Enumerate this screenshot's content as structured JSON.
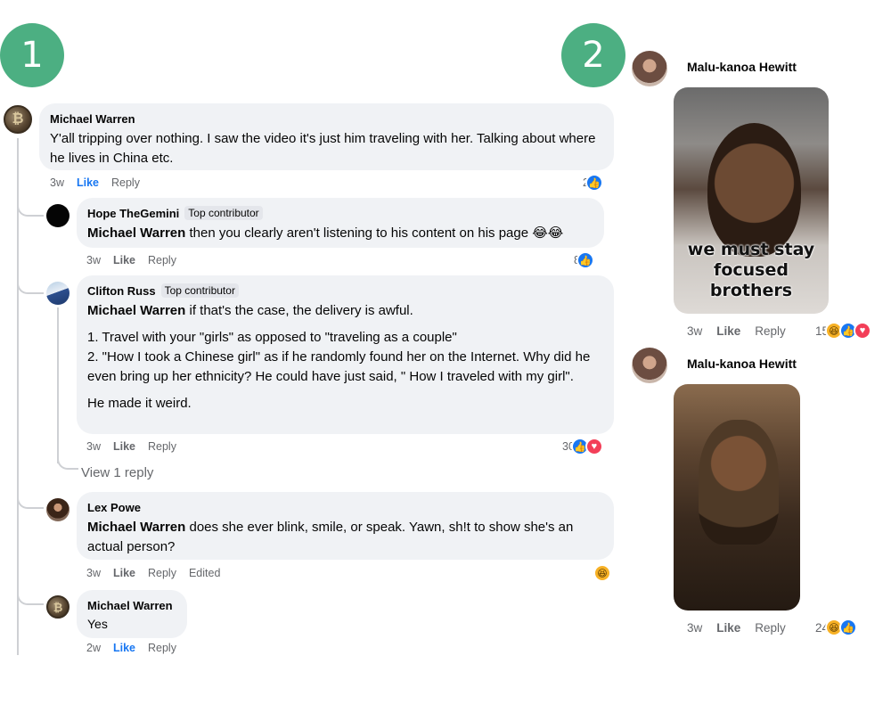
{
  "badges": {
    "left": "1",
    "right": "2"
  },
  "left_thread": {
    "main_comment": {
      "author": "Michael Warren",
      "text": "Y'all tripping over nothing. I saw the video it's just him traveling with her. Talking about where he lives in China etc.",
      "time": "3w",
      "like": "Like",
      "reply": "Reply",
      "reaction_count": "2",
      "reactions": [
        "like-icon"
      ]
    },
    "replies": [
      {
        "author": "Hope TheGemini",
        "tag": "Top contributor",
        "mention": "Michael Warren",
        "text": " then you clearly aren't listening to his content on his page 😂😂",
        "time": "3w",
        "like": "Like",
        "reply": "Reply",
        "reaction_count": "8",
        "reactions": [
          "like-icon"
        ]
      },
      {
        "author": "Clifton Russ",
        "tag": "Top contributor",
        "mention": "Michael Warren",
        "text": " if that's the case, the delivery is awful.",
        "paragraph2": "1. Travel with your \"girls\" as opposed to \"traveling as a couple\"\n2. \"How I took a Chinese girl\" as if he randomly found her on the Internet. Why did he even bring up her ethnicity? He could have just said, \" How I traveled with my girl\".",
        "paragraph3": "He made it weird.",
        "time": "3w",
        "like": "Like",
        "reply": "Reply",
        "reaction_count": "30",
        "reactions": [
          "like-icon",
          "love-icon"
        ]
      },
      {
        "view_reply": "View 1 reply"
      },
      {
        "author": "Lex Powe",
        "mention": "Michael Warren",
        "text": " does she ever blink, smile, or speak. Yawn, sh!t to show she's an actual person?",
        "time": "3w",
        "like": "Like",
        "reply": "Reply",
        "edited": "Edited",
        "reactions": [
          "haha-icon"
        ]
      },
      {
        "author": "Michael Warren",
        "text": "Yes",
        "time": "2w",
        "like": "Like",
        "reply": "Reply"
      }
    ]
  },
  "right_thread": {
    "comments": [
      {
        "author": "Malu-kanoa Hewitt",
        "gif_caption": "we must stay focused brothers",
        "time": "3w",
        "like": "Like",
        "reply": "Reply",
        "reaction_count": "15",
        "reactions": [
          "haha-icon",
          "like-icon",
          "love-icon"
        ]
      },
      {
        "author": "Malu-kanoa Hewitt",
        "time": "3w",
        "like": "Like",
        "reply": "Reply",
        "reaction_count": "24",
        "reactions": [
          "haha-icon",
          "like-icon"
        ]
      }
    ]
  },
  "colors": {
    "badge": "#4caf82",
    "bubble": "#f0f2f5",
    "like_blue": "#1877f2",
    "love_red": "#f33e58",
    "haha_yellow": "#f7b125",
    "meta_gray": "#65676b"
  }
}
